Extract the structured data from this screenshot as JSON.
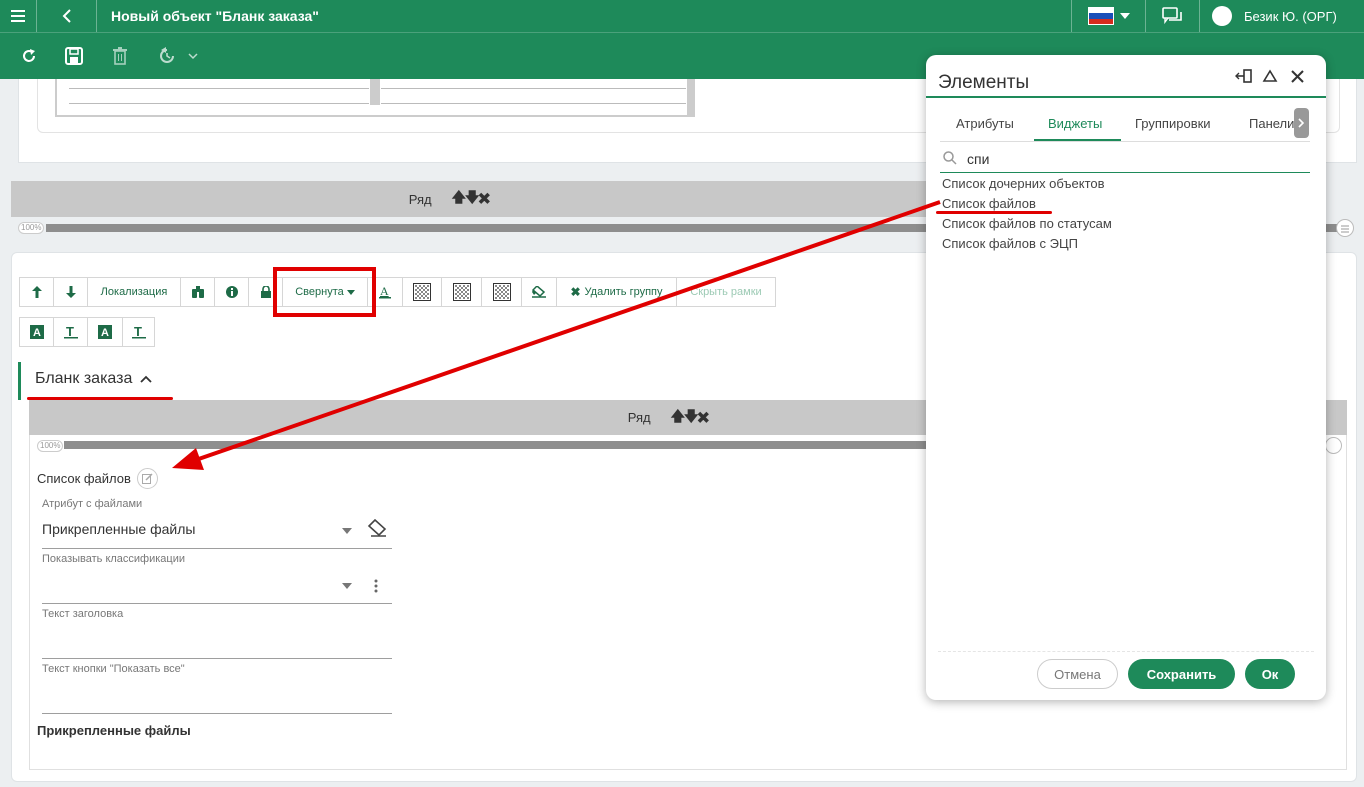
{
  "topbar": {
    "title": "Новый объект \"Бланк заказа\"",
    "user": "Безик Ю. (ОРГ)"
  },
  "row_bar": {
    "label": "Ряд",
    "arrows": "🡅🡇✖"
  },
  "percent": "100%",
  "group_toolbar": {
    "localization": "Локализация",
    "collapsed": "Свернута",
    "delete_group": "Удалить группу",
    "hide_frames": "Скрыть рамки"
  },
  "group": {
    "title": "Бланк заказа"
  },
  "widget": {
    "name": "Список файлов",
    "attr_label": "Атрибут с файлами",
    "attr_value": "Прикрепленные файлы",
    "classif_label": "Показывать классификации",
    "header_label": "Текст заголовка",
    "show_all_label": "Текст кнопки \"Показать все\"",
    "preview_title": "Прикрепленные файлы"
  },
  "dialog": {
    "title": "Элементы",
    "tabs": [
      "Атрибуты",
      "Виджеты",
      "Группировки",
      "Панели"
    ],
    "search_value": "спи",
    "results": [
      "Список дочерних объектов",
      "Список файлов",
      "Список файлов по статусам",
      "Список файлов с ЭЦП"
    ],
    "cancel": "Отмена",
    "save": "Сохранить",
    "ok": "Ок"
  },
  "colors": {
    "brand": "#1e8a5a",
    "annotation": "#e00000"
  }
}
